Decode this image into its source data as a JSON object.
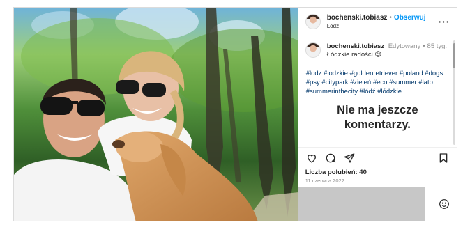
{
  "post": {
    "username": "bochenski.tobiasz",
    "separator": "•",
    "follow_label": "Obserwuj",
    "location": "Łódź"
  },
  "caption": {
    "username": "bochenski.tobiasz",
    "edited": "Edytowany",
    "separator": "•",
    "age": "85 tyg.",
    "text": "Łódzkie radości 😊",
    "hashtags": "#lodz #lodzkie #goldenretriever #poland #dogs #psy #citypark #zieleń #eco #summer #lato #summerinthecity #łódź #łódzkie"
  },
  "empty_comments": "Nie ma jeszcze komentarzy.",
  "likes": "Liczba polubień: 40",
  "date": "11 czerwca 2022",
  "icons": {
    "more": "more-options-icon",
    "like": "heart-icon",
    "comment": "comment-icon",
    "share": "send-icon",
    "save": "bookmark-icon",
    "emoji": "emoji-icon"
  },
  "colors": {
    "accent": "#0095f6",
    "hashtag": "#00376b",
    "muted": "#8e8e8e",
    "comment_box": "#c7c7c7"
  }
}
